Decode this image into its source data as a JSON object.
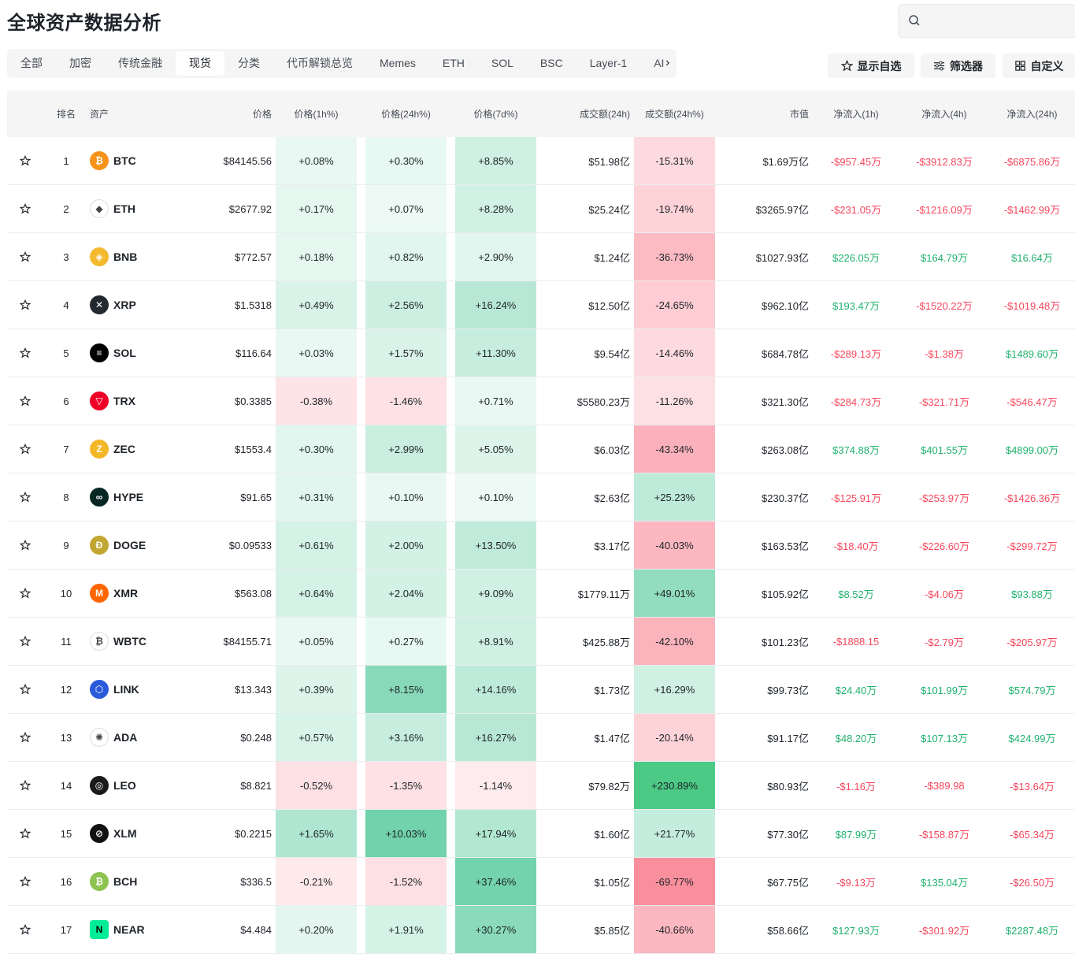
{
  "page": {
    "title": "全球资产数据分析",
    "search_placeholder": ""
  },
  "tabs": [
    "全部",
    "加密",
    "传统金融",
    "现货",
    "分类",
    "代币解锁总览",
    "Memes",
    "ETH",
    "SOL",
    "BSC",
    "Layer-1",
    "AI"
  ],
  "active_tab": "现货",
  "toolbar": {
    "watchlist": "显示自选",
    "filter": "筛选器",
    "customize": "自定义"
  },
  "columns": [
    "",
    "排名",
    "资产",
    "价格",
    "价格(1h%)",
    "价格(24h%)",
    "价格(7d%)",
    "成交额(24h)",
    "成交额(24h%)",
    "市值",
    "净流入(1h)",
    "净流入(4h)",
    "净流入(24h)"
  ],
  "rows": [
    {
      "rank": "1",
      "symbol": "BTC",
      "price": "$84145.56",
      "p1h": "+0.08%",
      "p24h": "+0.30%",
      "p7d": "+8.85%",
      "vol": "$51.98亿",
      "vol_chg": "-15.31%",
      "mcap": "$1.69万亿",
      "f1h": "-$957.45万",
      "f4h": "-$3912.83万",
      "f24h": "-$6875.86万",
      "icon": "btc-icon",
      "color": "#f7931a",
      "glyph": "₿"
    },
    {
      "rank": "2",
      "symbol": "ETH",
      "price": "$2677.92",
      "p1h": "+0.17%",
      "p24h": "+0.07%",
      "p7d": "+8.28%",
      "vol": "$25.24亿",
      "vol_chg": "-19.74%",
      "mcap": "$3265.97亿",
      "f1h": "-$231.05万",
      "f4h": "-$1216.09万",
      "f24h": "-$1462.99万",
      "icon": "eth-icon",
      "color": "#ffffff",
      "glyph": "◆"
    },
    {
      "rank": "3",
      "symbol": "BNB",
      "price": "$772.57",
      "p1h": "+0.18%",
      "p24h": "+0.82%",
      "p7d": "+2.90%",
      "vol": "$1.24亿",
      "vol_chg": "-36.73%",
      "mcap": "$1027.93亿",
      "f1h": "$226.05万",
      "f4h": "$164.79万",
      "f24h": "$16.64万",
      "icon": "bnb-icon",
      "color": "#f3ba2f",
      "glyph": "◈"
    },
    {
      "rank": "4",
      "symbol": "XRP",
      "price": "$1.5318",
      "p1h": "+0.49%",
      "p24h": "+2.56%",
      "p7d": "+16.24%",
      "vol": "$12.50亿",
      "vol_chg": "-24.65%",
      "mcap": "$962.10亿",
      "f1h": "$193.47万",
      "f4h": "-$1520.22万",
      "f24h": "-$1019.48万",
      "icon": "xrp-icon",
      "color": "#23292f",
      "glyph": "✕"
    },
    {
      "rank": "5",
      "symbol": "SOL",
      "price": "$116.64",
      "p1h": "+0.03%",
      "p24h": "+1.57%",
      "p7d": "+11.30%",
      "vol": "$9.54亿",
      "vol_chg": "-14.46%",
      "mcap": "$684.78亿",
      "f1h": "-$289.13万",
      "f4h": "-$1.38万",
      "f24h": "$1489.60万",
      "icon": "sol-icon",
      "color": "#000000",
      "glyph": "≡"
    },
    {
      "rank": "6",
      "symbol": "TRX",
      "price": "$0.3385",
      "p1h": "-0.38%",
      "p24h": "-1.46%",
      "p7d": "+0.71%",
      "vol": "$5580.23万",
      "vol_chg": "-11.26%",
      "mcap": "$321.30亿",
      "f1h": "-$284.73万",
      "f4h": "-$321.71万",
      "f24h": "-$546.47万",
      "icon": "trx-icon",
      "color": "#ef0027",
      "glyph": "▽"
    },
    {
      "rank": "7",
      "symbol": "ZEC",
      "price": "$1553.4",
      "p1h": "+0.30%",
      "p24h": "+2.99%",
      "p7d": "+5.05%",
      "vol": "$6.03亿",
      "vol_chg": "-43.34%",
      "mcap": "$263.08亿",
      "f1h": "$374.88万",
      "f4h": "$401.55万",
      "f24h": "$4899.00万",
      "icon": "zec-icon",
      "color": "#f4b728",
      "glyph": "Z"
    },
    {
      "rank": "8",
      "symbol": "HYPE",
      "price": "$91.65",
      "p1h": "+0.31%",
      "p24h": "+0.10%",
      "p7d": "+0.10%",
      "vol": "$2.63亿",
      "vol_chg": "+25.23%",
      "mcap": "$230.37亿",
      "f1h": "-$125.91万",
      "f4h": "-$253.97万",
      "f24h": "-$1426.36万",
      "icon": "hype-icon",
      "color": "#072723",
      "glyph": "∞"
    },
    {
      "rank": "9",
      "symbol": "DOGE",
      "price": "$0.09533",
      "p1h": "+0.61%",
      "p24h": "+2.00%",
      "p7d": "+13.50%",
      "vol": "$3.17亿",
      "vol_chg": "-40.03%",
      "mcap": "$163.53亿",
      "f1h": "-$18.40万",
      "f4h": "-$226.60万",
      "f24h": "-$299.72万",
      "icon": "doge-icon",
      "color": "#c2a633",
      "glyph": "Ð"
    },
    {
      "rank": "10",
      "symbol": "XMR",
      "price": "$563.08",
      "p1h": "+0.64%",
      "p24h": "+2.04%",
      "p7d": "+9.09%",
      "vol": "$1779.11万",
      "vol_chg": "+49.01%",
      "mcap": "$105.92亿",
      "f1h": "$8.52万",
      "f4h": "-$4.06万",
      "f24h": "$93.88万",
      "icon": "xmr-icon",
      "color": "#ff6600",
      "glyph": "M"
    },
    {
      "rank": "11",
      "symbol": "WBTC",
      "price": "$84155.71",
      "p1h": "+0.05%",
      "p24h": "+0.27%",
      "p7d": "+8.91%",
      "vol": "$425.88万",
      "vol_chg": "-42.10%",
      "mcap": "$101.23亿",
      "f1h": "-$1888.15",
      "f4h": "-$2.79万",
      "f24h": "-$205.97万",
      "icon": "wbtc-icon",
      "color": "#ffffff",
      "glyph": "₿"
    },
    {
      "rank": "12",
      "symbol": "LINK",
      "price": "$13.343",
      "p1h": "+0.39%",
      "p24h": "+8.15%",
      "p7d": "+14.16%",
      "vol": "$1.73亿",
      "vol_chg": "+16.29%",
      "mcap": "$99.73亿",
      "f1h": "$24.40万",
      "f4h": "$101.99万",
      "f24h": "$574.79万",
      "icon": "link-icon",
      "color": "#2a5ada",
      "glyph": "⬡"
    },
    {
      "rank": "13",
      "symbol": "ADA",
      "price": "$0.248",
      "p1h": "+0.57%",
      "p24h": "+3.16%",
      "p7d": "+16.27%",
      "vol": "$1.47亿",
      "vol_chg": "-20.14%",
      "mcap": "$91.17亿",
      "f1h": "$48.20万",
      "f4h": "$107.13万",
      "f24h": "$424.99万",
      "icon": "ada-icon",
      "color": "#ffffff",
      "glyph": "✺"
    },
    {
      "rank": "14",
      "symbol": "LEO",
      "price": "$8.821",
      "p1h": "-0.52%",
      "p24h": "-1.35%",
      "p7d": "-1.14%",
      "vol": "$79.82万",
      "vol_chg": "+230.89%",
      "mcap": "$80.93亿",
      "f1h": "-$1.16万",
      "f4h": "-$389.98",
      "f24h": "-$13.64万",
      "icon": "leo-icon",
      "color": "#1a1a1a",
      "glyph": "◎"
    },
    {
      "rank": "15",
      "symbol": "XLM",
      "price": "$0.2215",
      "p1h": "+1.65%",
      "p24h": "+10.03%",
      "p7d": "+17.94%",
      "vol": "$1.60亿",
      "vol_chg": "+21.77%",
      "mcap": "$77.30亿",
      "f1h": "$87.99万",
      "f4h": "-$158.87万",
      "f24h": "-$65.34万",
      "icon": "xlm-icon",
      "color": "#111111",
      "glyph": "⊘"
    },
    {
      "rank": "16",
      "symbol": "BCH",
      "price": "$336.5",
      "p1h": "-0.21%",
      "p24h": "-1.52%",
      "p7d": "+37.46%",
      "vol": "$1.05亿",
      "vol_chg": "-69.77%",
      "mcap": "$67.75亿",
      "f1h": "-$9.13万",
      "f4h": "$135.04万",
      "f24h": "-$26.50万",
      "icon": "bch-icon",
      "color": "#8dc351",
      "glyph": "₿"
    },
    {
      "rank": "17",
      "symbol": "NEAR",
      "price": "$4.484",
      "p1h": "+0.20%",
      "p24h": "+1.91%",
      "p7d": "+30.27%",
      "vol": "$5.85亿",
      "vol_chg": "-40.66%",
      "mcap": "$58.66亿",
      "f1h": "$127.93万",
      "f4h": "-$301.92万",
      "f24h": "$2287.48万",
      "icon": "near-icon",
      "color": "#00ec97",
      "glyph": "N"
    }
  ],
  "colors": {
    "up": "#20b26c",
    "down": "#f6465d",
    "header_bg": "#f5f5f5",
    "heat_up": "#2ebd85",
    "heat_down": "#f6465d"
  }
}
